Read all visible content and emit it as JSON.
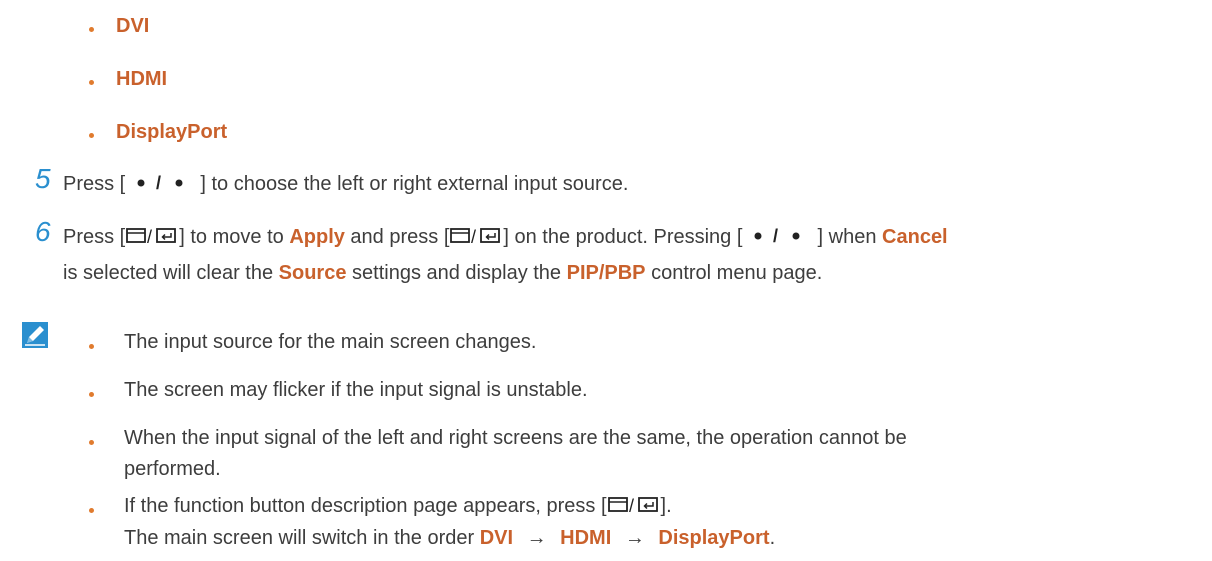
{
  "top_bullets": [
    "DVI",
    "HDMI",
    "DisplayPort"
  ],
  "step5": {
    "number": "5",
    "t1": "Press [ ",
    "t2": " ] to choose the left or right external input source."
  },
  "step6": {
    "number": "6",
    "t1": "Press [",
    "t2": "] to move to ",
    "h1": "Apply",
    "t3": " and press [",
    "t4": "] on the product. Pressing  [ ",
    "t5": " ] when ",
    "h2": "Cancel",
    "line2_t1": "is selected will clear the ",
    "h3": "Source",
    "line2_t2": " settings and display the ",
    "h4": "PIP/PBP",
    "line2_t3": " control menu page."
  },
  "notes": {
    "n1": "The input source for the main screen changes.",
    "n2": "The screen may flicker if the input signal is unstable.",
    "n3_line1": "When the input signal of the left and right screens are the same, the operation cannot be",
    "n3_line2": "performed.",
    "n4_line1_t1": "If the function button description page appears, press  [",
    "n4_line1_t2": "].",
    "n4_line2_t1": "The main screen will switch in the order ",
    "n4_h1": "DVI",
    "n4_arrow1": "→",
    "n4_h2": "HDMI",
    "n4_arrow2": "→",
    "n4_h3": "DisplayPort",
    "n4_end": "."
  },
  "colors": {
    "highlight": "#c9612c",
    "step_number": "#2a8fcf",
    "note_icon": "#2a8fcf",
    "bullet": "#e07b2e"
  },
  "icons": {
    "nav_dot": "bullet-dot-icon",
    "source_enter": "source-enter-icon",
    "note": "note-pencil-icon"
  }
}
